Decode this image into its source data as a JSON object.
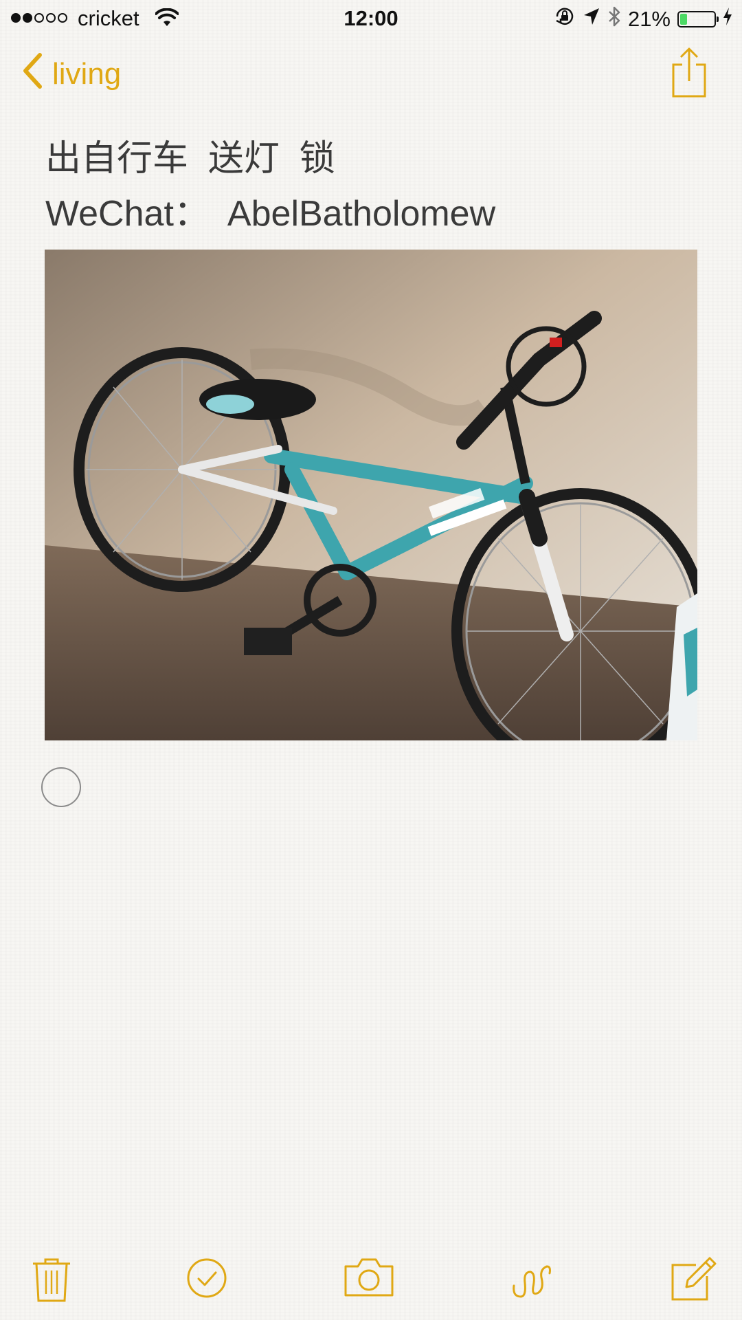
{
  "status_bar": {
    "carrier": "cricket",
    "time": "12:00",
    "battery_percent": "21%",
    "battery_level": 0.21,
    "signal_bars_filled": 2,
    "signal_bars_total": 5
  },
  "nav": {
    "back_label": "living",
    "back_icon": "chevron-left-icon",
    "share_icon": "share-icon"
  },
  "note": {
    "line1": "出自行车  送灯  锁",
    "line2": "WeChat：  AbelBatholomew",
    "image_alt": "bicycle photo"
  },
  "toolbar": {
    "items": [
      "trash-icon",
      "checklist-icon",
      "camera-icon",
      "sketch-icon",
      "compose-icon"
    ]
  },
  "colors": {
    "accent": "#e0a814",
    "text": "#3a3a3a",
    "background": "#f7f6f3",
    "battery": "#4cd964"
  }
}
